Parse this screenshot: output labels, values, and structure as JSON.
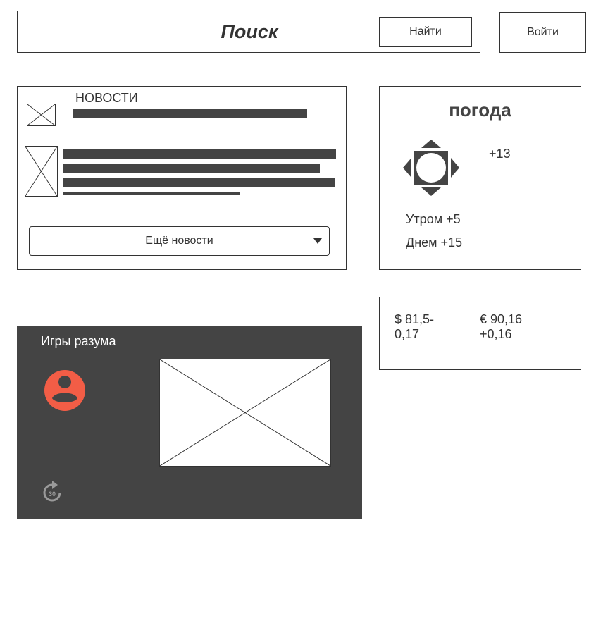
{
  "header": {
    "search_title": "Поиск",
    "search_button": "Найти",
    "login_button": "Войти"
  },
  "news": {
    "title": "НОВОСТИ",
    "more_button": "Ещё новости"
  },
  "weather": {
    "title": "погода",
    "current": "+13",
    "morning": "Утром +5",
    "day": "Днем +15",
    "icon": "sun-icon"
  },
  "currency": {
    "usd": "$ 81,5-0,17",
    "eur": "€ 90,16 +0,16"
  },
  "games": {
    "title": "Игры разума",
    "avatar_icon": "user-circle-icon",
    "replay_icon": "replay-30-icon",
    "replay_label": "30"
  },
  "colors": {
    "stroke": "#333333",
    "dark_panel": "#444444",
    "accent": "#f25d46"
  }
}
